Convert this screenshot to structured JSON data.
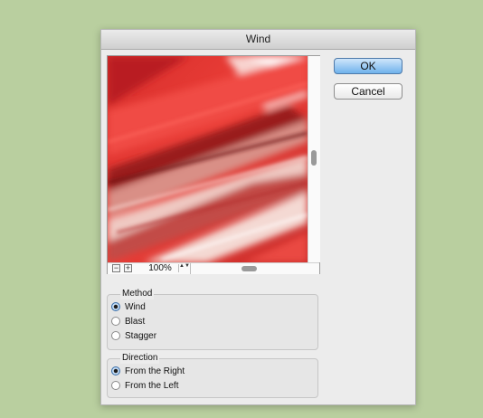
{
  "dialog": {
    "title": "Wind",
    "ok_label": "OK",
    "cancel_label": "Cancel"
  },
  "preview": {
    "zoom_out_symbol": "−",
    "zoom_in_symbol": "+",
    "zoom_value": "100%",
    "spin_symbol": "▲▼"
  },
  "method": {
    "legend": "Method",
    "options": [
      "Wind",
      "Blast",
      "Stagger"
    ],
    "selected": "Wind"
  },
  "direction": {
    "legend": "Direction",
    "options": [
      "From the Right",
      "From the Left"
    ],
    "selected": "From the Right"
  },
  "colors": {
    "desktop_bg": "#b9cf9f",
    "dialog_bg": "#ececec",
    "ok_button": "#6fb2ec",
    "preview_red": "#e23a36"
  }
}
